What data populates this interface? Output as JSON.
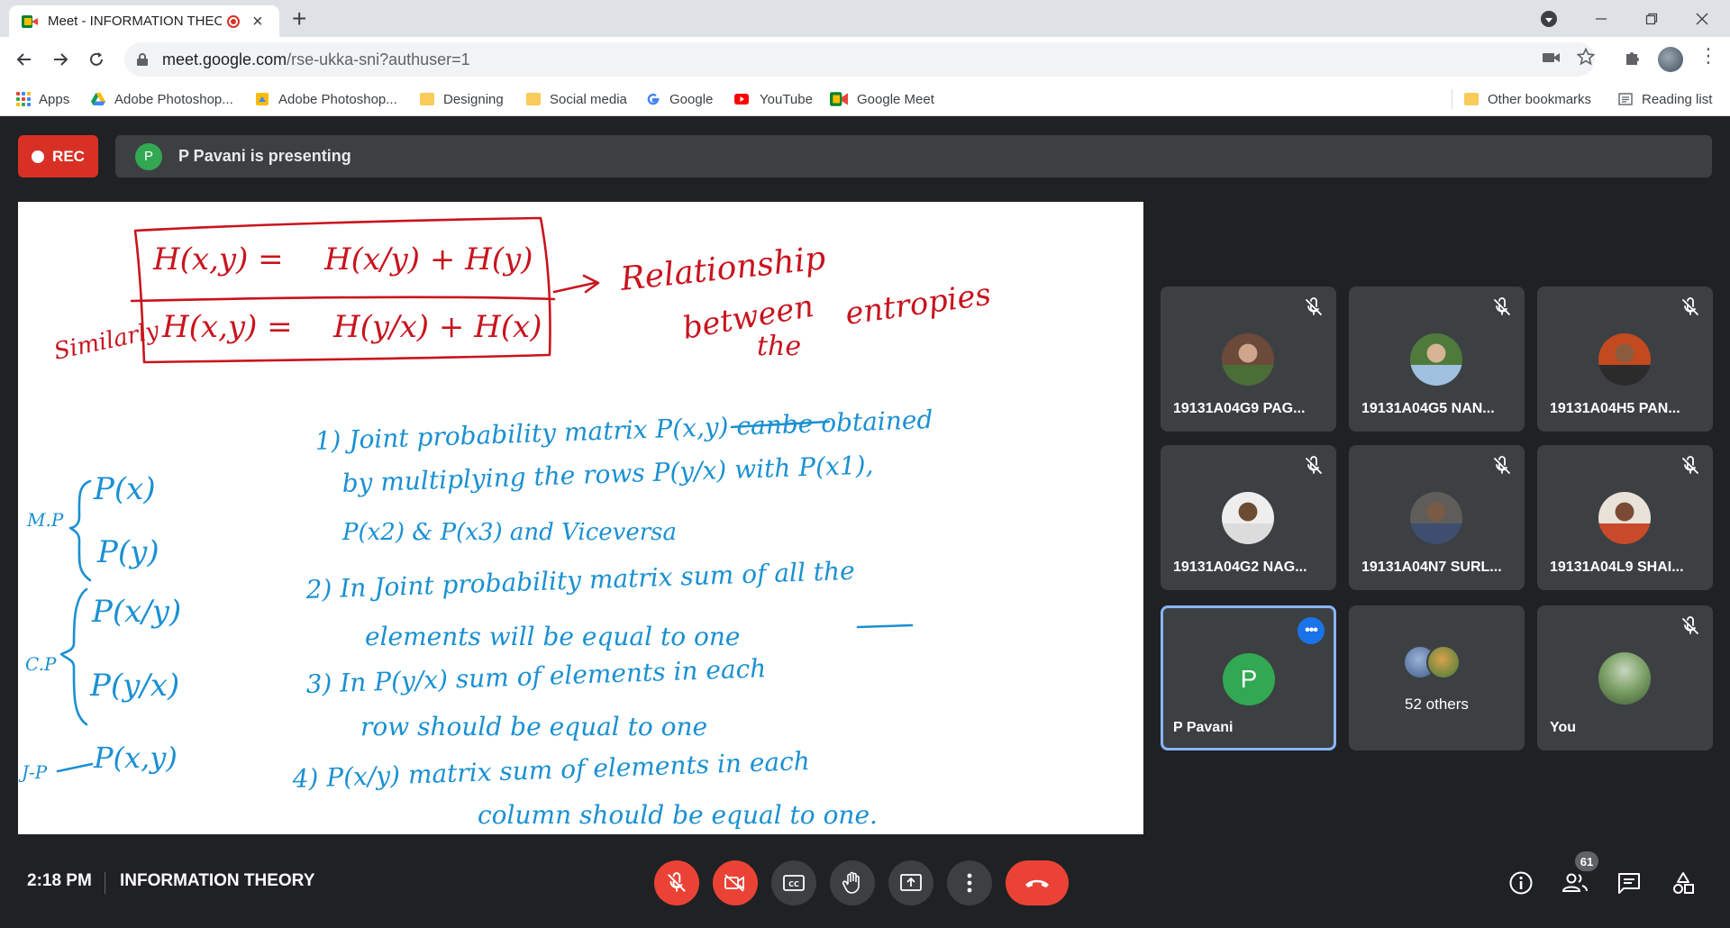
{
  "browser": {
    "tab_title": "Meet - INFORMATION THEO",
    "url_host": "meet.google.com",
    "url_path": "/rse-ukka-sni?authuser=1",
    "bookmarks": [
      {
        "label": "Apps",
        "icon": "apps-grid-icon"
      },
      {
        "label": "Adobe Photoshop...",
        "icon": "google-drive-icon"
      },
      {
        "label": "Adobe Photoshop...",
        "icon": "drive-file-icon"
      },
      {
        "label": "Designing",
        "icon": "folder-icon"
      },
      {
        "label": "Social media",
        "icon": "folder-icon"
      },
      {
        "label": "Google",
        "icon": "google-icon"
      },
      {
        "label": "YouTube",
        "icon": "youtube-icon"
      },
      {
        "label": "Google Meet",
        "icon": "meet-icon"
      }
    ],
    "other_bookmarks": "Other bookmarks",
    "reading_list": "Reading list"
  },
  "meet": {
    "rec_label": "REC",
    "presenter_initial": "P",
    "presenting_text": "P Pavani is presenting",
    "participants": [
      {
        "name": "19131A04G9 PAG...",
        "muted": true,
        "avatar_colors": [
          "#6b4a3a",
          "#cfa58b",
          "#4b6d38"
        ]
      },
      {
        "name": "19131A04G5 NAN...",
        "muted": true,
        "avatar_colors": [
          "#4e7a3c",
          "#d7b496",
          "#a0c0e0"
        ]
      },
      {
        "name": "19131A04H5 PAN...",
        "muted": true,
        "avatar_colors": [
          "#c24a1e",
          "#8b5b3e",
          "#2b2b2b"
        ]
      },
      {
        "name": "19131A04G2 NAG...",
        "muted": true,
        "avatar_colors": [
          "#eeeeee",
          "#6b4b33",
          "#dcdcdc"
        ]
      },
      {
        "name": "19131A04N7 SURL...",
        "muted": true,
        "avatar_colors": [
          "#5e5d5a",
          "#7a5a44",
          "#3f4d6e"
        ]
      },
      {
        "name": "19131A04L9 SHAI...",
        "muted": true,
        "avatar_colors": [
          "#e8e2d8",
          "#7b4a35",
          "#c84a2a"
        ]
      }
    ],
    "presenter_tile": {
      "initial": "P",
      "name": "P Pavani"
    },
    "others": {
      "label": "52 others"
    },
    "self": {
      "name": "You",
      "muted": true
    },
    "meeting_time": "2:18 PM",
    "meeting_title": "INFORMATION THEORY",
    "people_count": "61"
  },
  "slide": {
    "red": {
      "eq1_left": "H(x,y) =",
      "eq1_right": "H(x/y) + H(y)",
      "similarly": "Similarly",
      "eq2_left": "H(x,y) =",
      "eq2_right": "H(y/x) + H(x)",
      "rel_1": "Relationship",
      "rel_2": "between",
      "rel_3": "the",
      "rel_4": "entropies"
    },
    "blue": {
      "side_mp": "M.P",
      "side_px": "P(x)",
      "side_py": "P(y)",
      "side_cp": "C.P",
      "side_pxy": "P(x/y)",
      "side_pyx": "P(y/x)",
      "side_jp": "J-P",
      "side_pjoint": "P(x,y)",
      "l1a": "1) Joint probability matrix P(x,y) canbe obtained",
      "l1b": "by multiplying the rows P(y/x) with P(x1),",
      "l1c": "P(x2) & P(x3) and Viceversa",
      "l2a": "2) In Joint probability matrix sum of all the",
      "l2b": "elements will be equal to one",
      "l3a": "3) In P(y/x) sum of elements in each",
      "l3b": "row should be equal to one",
      "l4a": "4) P(x/y) matrix sum of elements in each",
      "l4b": "column should be equal to one."
    }
  }
}
